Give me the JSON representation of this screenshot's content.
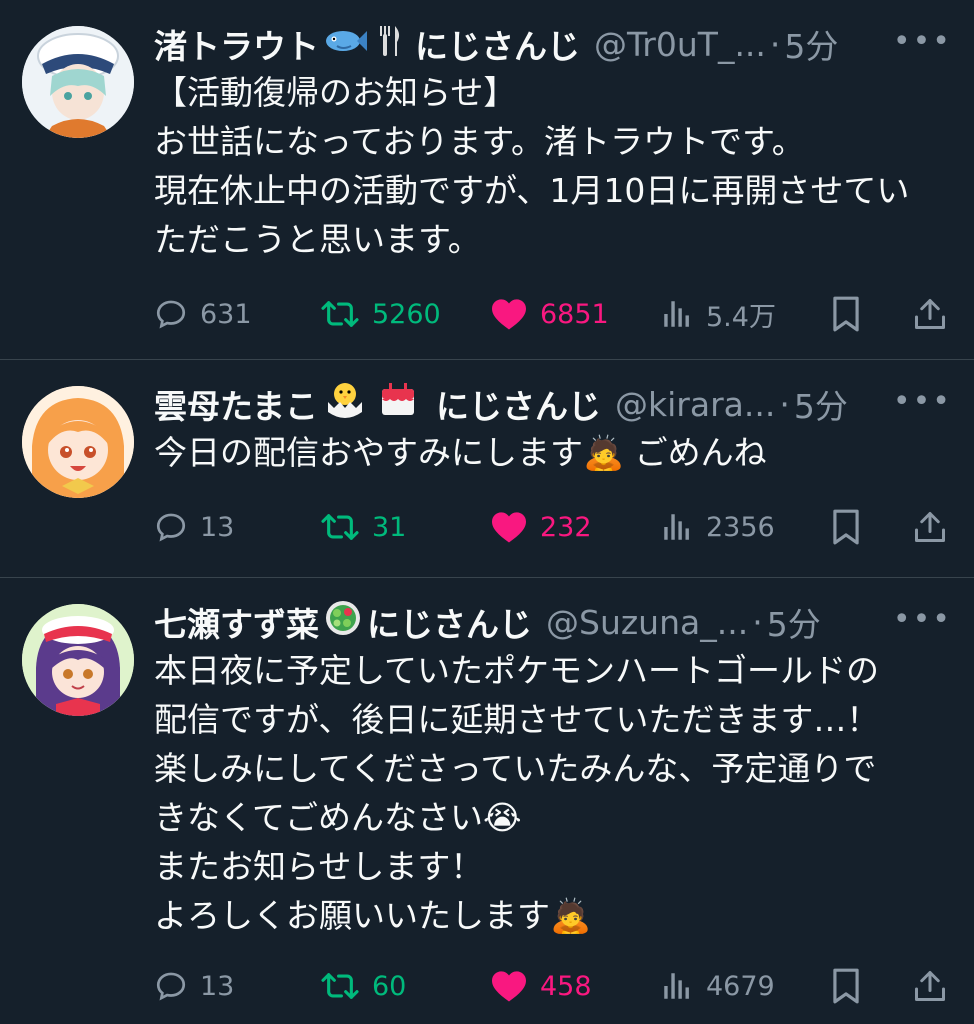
{
  "tweets": [
    {
      "name": "渚トラウト",
      "emojis": [
        "fish-emoji",
        "fork-knife-emoji"
      ],
      "org": "にじさんじ",
      "handle": "@Tr0uT_...",
      "time": "5分",
      "body": "【活動復帰のお知らせ】\nお世話になっております。渚トラウトです。\n現在休止中の活動ですが、1月10日に再開させてい\nただこうと思います。",
      "replies": "631",
      "retweets": "5260",
      "likes": "6851",
      "views": "5.4万",
      "avatar_color": "#e9f0f5"
    },
    {
      "name": "雲母たまこ",
      "emojis": [
        "hatching-chick-emoji",
        "birthday-cake-emoji"
      ],
      "org": "にじさんじ",
      "handle": "@kirara...",
      "time": "5分",
      "body": "今日の配信おやすみにします🙇 ごめんね",
      "replies": "13",
      "retweets": "31",
      "likes": "232",
      "views": "2356",
      "avatar_color": "#fbe0c6"
    },
    {
      "name": "七瀬すず菜",
      "emojis": [
        "salad-emoji"
      ],
      "org": "にじさんじ",
      "handle": "@Suzuna_...",
      "time": "5分",
      "body": "本日夜に予定していたポケモンハートゴールドの\n配信ですが、後日に延期させていただきます…！\n楽しみにしてくださっていたみんな、予定通りで\nきなくてごめんなさい😭\nまたお知らせします！\nよろしくお願いいたします🙇",
      "replies": "13",
      "retweets": "60",
      "likes": "458",
      "views": "4679",
      "avatar_color": "#d8efc4"
    }
  ],
  "ui": {
    "more_label": "•••",
    "separator": "·"
  },
  "colors": {
    "background": "#15202b",
    "retweet": "#00ba7c",
    "like": "#f91880",
    "muted": "#8b98a5"
  }
}
